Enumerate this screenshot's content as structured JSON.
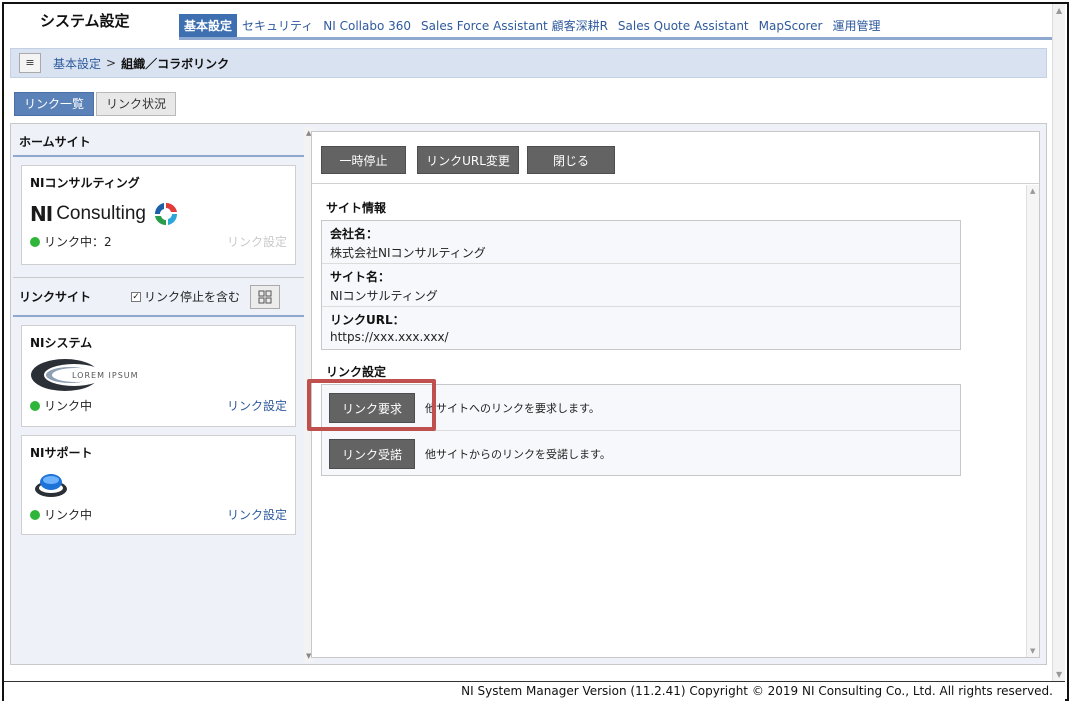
{
  "header": {
    "app_title": "システム設定",
    "tabs": [
      {
        "label": "基本設定",
        "active": true
      },
      {
        "label": "セキュリティ",
        "active": false
      },
      {
        "label": "NI Collabo 360",
        "active": false
      },
      {
        "label": "Sales Force Assistant 顧客深耕R",
        "active": false
      },
      {
        "label": "Sales Quote Assistant",
        "active": false
      },
      {
        "label": "MapScorer",
        "active": false
      },
      {
        "label": "運用管理",
        "active": false
      }
    ]
  },
  "breadcrumb": {
    "menu_icon": "≡",
    "parent": "基本設定",
    "separator": ">",
    "current": "組織／コラボリンク"
  },
  "view_tabs": [
    {
      "label": "リンク一覧",
      "active": true
    },
    {
      "label": "リンク状況",
      "active": false
    }
  ],
  "left": {
    "home_section": "ホームサイト",
    "home_card": {
      "title": "NIコンサルティング",
      "logo_text_ni": "NI",
      "logo_text_rest": "Consulting",
      "status": "リンク中：2",
      "setting_label": "リンク設定"
    },
    "link_section": "リンクサイト",
    "include_stopped_label": "リンク停止を含む",
    "include_stopped_checked": true,
    "sites": [
      {
        "title": "NIシステム",
        "logo_text": "LOREM IPSUM",
        "status": "リンク中",
        "setting_label": "リンク設定"
      },
      {
        "title": "NIサポート",
        "status": "リンク中",
        "setting_label": "リンク設定"
      }
    ]
  },
  "right": {
    "toolbar": {
      "pause": "一時停止",
      "change_url": "リンクURL変更",
      "close": "閉じる"
    },
    "site_info_title": "サイト情報",
    "site_info": [
      {
        "label": "会社名：",
        "value": "株式会社NIコンサルティング"
      },
      {
        "label": "サイト名：",
        "value": "NIコンサルティング"
      },
      {
        "label": "リンクURL：",
        "value": "https://xxx.xxx.xxx/"
      }
    ],
    "link_setting_title": "リンク設定",
    "link_settings": [
      {
        "button": "リンク要求",
        "description": "他サイトへのリンクを要求します。"
      },
      {
        "button": "リンク受諾",
        "description": "他サイトからのリンクを受諾します。"
      }
    ]
  },
  "footer": {
    "text": "NI System Manager Version (11.2.41) Copyright © 2019 NI Consulting Co., Ltd. All rights reserved."
  },
  "colors": {
    "accent": "#3d6fb1",
    "status_green": "#2fb53a",
    "highlight": "#c0504d"
  }
}
